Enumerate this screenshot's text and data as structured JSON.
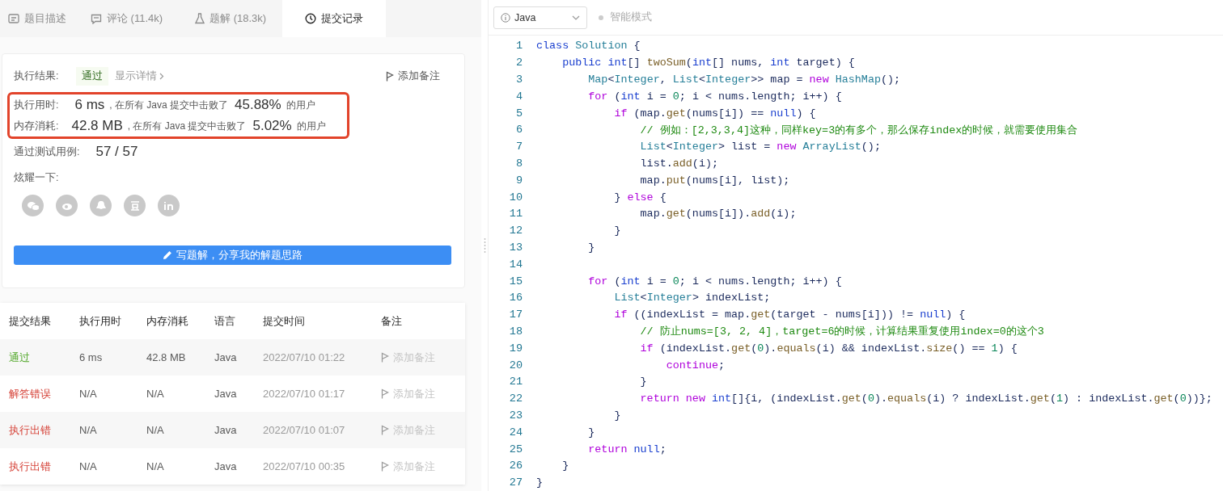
{
  "tabs": [
    {
      "label": "题目描述",
      "selected": false
    },
    {
      "label": "评论 (11.4k)",
      "selected": false
    },
    {
      "label": "题解 (18.3k)",
      "selected": false
    },
    {
      "label": "提交记录",
      "selected": true
    }
  ],
  "result": {
    "label": "执行结果:",
    "status": "通过",
    "details_link": "显示详情",
    "note_button": "添加备注"
  },
  "stats": {
    "highlighted": true,
    "rows": [
      {
        "label": "执行用时:",
        "value": "6 ms",
        "text": ", 在所有 Java 提交中击败了",
        "percent": "45.88%",
        "suffix": "的用户"
      },
      {
        "label": "内存消耗:",
        "value": "42.8 MB",
        "text": ", 在所有 Java 提交中击败了",
        "percent": "5.02%",
        "suffix": "的用户"
      }
    ]
  },
  "tests": {
    "label": "通过测试用例:",
    "value": "57 / 57"
  },
  "share": {
    "label": "炫耀一下:"
  },
  "write_button": "写题解，分享我的解题思路",
  "table": {
    "columns": [
      "提交结果",
      "执行用时",
      "内存消耗",
      "语言",
      "提交时间",
      "备注"
    ],
    "rows": [
      {
        "result": "通过",
        "kind": "pass",
        "time": "6 ms",
        "memory": "42.8 MB",
        "language": "Java",
        "submitted": "2022/07/10 01:22",
        "note": "添加备注"
      },
      {
        "result": "解答错误",
        "kind": "fail",
        "time": "N/A",
        "memory": "N/A",
        "language": "Java",
        "submitted": "2022/07/10 01:17",
        "note": "添加备注"
      },
      {
        "result": "执行出错",
        "kind": "fail",
        "time": "N/A",
        "memory": "N/A",
        "language": "Java",
        "submitted": "2022/07/10 01:07",
        "note": "添加备注"
      },
      {
        "result": "执行出错",
        "kind": "fail",
        "time": "N/A",
        "memory": "N/A",
        "language": "Java",
        "submitted": "2022/07/10 00:35",
        "note": "添加备注"
      }
    ]
  },
  "editor": {
    "language": "Java",
    "mode": "智能模式",
    "lines": [
      {
        "number": "1",
        "tokens": [
          {
            "kind": "keyword",
            "text": "class"
          },
          {
            "kind": "type",
            "text": " Solution"
          },
          {
            "kind": "plain",
            "text": " {"
          }
        ]
      },
      {
        "number": "2",
        "tokens": [
          {
            "kind": "keyword",
            "text": "    public"
          },
          {
            "kind": "keyword",
            "text": " int"
          },
          {
            "kind": "plain",
            "text": "[] "
          },
          {
            "kind": "function",
            "text": "twoSum"
          },
          {
            "kind": "plain",
            "text": "("
          },
          {
            "kind": "keyword",
            "text": "int"
          },
          {
            "kind": "plain",
            "text": "[] nums, "
          },
          {
            "kind": "keyword",
            "text": "int"
          },
          {
            "kind": "plain",
            "text": " target) {"
          }
        ]
      },
      {
        "number": "3",
        "tokens": [
          {
            "kind": "type",
            "text": "        Map"
          },
          {
            "kind": "plain",
            "text": "<"
          },
          {
            "kind": "type",
            "text": "Integer"
          },
          {
            "kind": "plain",
            "text": ", "
          },
          {
            "kind": "type",
            "text": "List"
          },
          {
            "kind": "plain",
            "text": "<"
          },
          {
            "kind": "type",
            "text": "Integer"
          },
          {
            "kind": "plain",
            "text": ">> map = "
          },
          {
            "kind": "control",
            "text": "new"
          },
          {
            "kind": "type",
            "text": " HashMap"
          },
          {
            "kind": "plain",
            "text": "();"
          }
        ]
      },
      {
        "number": "4",
        "tokens": [
          {
            "kind": "control",
            "text": "        for"
          },
          {
            "kind": "plain",
            "text": " ("
          },
          {
            "kind": "keyword",
            "text": "int"
          },
          {
            "kind": "plain",
            "text": " i = "
          },
          {
            "kind": "number",
            "text": "0"
          },
          {
            "kind": "plain",
            "text": "; i < nums.length; i++) {"
          }
        ]
      },
      {
        "number": "5",
        "tokens": [
          {
            "kind": "control",
            "text": "            if"
          },
          {
            "kind": "plain",
            "text": " (map."
          },
          {
            "kind": "function",
            "text": "get"
          },
          {
            "kind": "plain",
            "text": "(nums[i]) == "
          },
          {
            "kind": "keyword",
            "text": "null"
          },
          {
            "kind": "plain",
            "text": ") {"
          }
        ]
      },
      {
        "number": "6",
        "tokens": [
          {
            "kind": "comment",
            "text": "                // 例如：[2,3,3,4]这种，同样key=3的有多个，那么保存index的时候，就需要使用集合"
          }
        ]
      },
      {
        "number": "7",
        "tokens": [
          {
            "kind": "type",
            "text": "                List"
          },
          {
            "kind": "plain",
            "text": "<"
          },
          {
            "kind": "type",
            "text": "Integer"
          },
          {
            "kind": "plain",
            "text": "> list = "
          },
          {
            "kind": "control",
            "text": "new"
          },
          {
            "kind": "type",
            "text": " ArrayList"
          },
          {
            "kind": "plain",
            "text": "();"
          }
        ]
      },
      {
        "number": "8",
        "tokens": [
          {
            "kind": "plain",
            "text": "                list."
          },
          {
            "kind": "function",
            "text": "add"
          },
          {
            "kind": "plain",
            "text": "(i);"
          }
        ]
      },
      {
        "number": "9",
        "tokens": [
          {
            "kind": "plain",
            "text": "                map."
          },
          {
            "kind": "function",
            "text": "put"
          },
          {
            "kind": "plain",
            "text": "(nums[i], list);"
          }
        ]
      },
      {
        "number": "10",
        "tokens": [
          {
            "kind": "plain",
            "text": "            } "
          },
          {
            "kind": "control",
            "text": "else"
          },
          {
            "kind": "plain",
            "text": " {"
          }
        ]
      },
      {
        "number": "11",
        "tokens": [
          {
            "kind": "plain",
            "text": "                map."
          },
          {
            "kind": "function",
            "text": "get"
          },
          {
            "kind": "plain",
            "text": "(nums[i])."
          },
          {
            "kind": "function",
            "text": "add"
          },
          {
            "kind": "plain",
            "text": "(i);"
          }
        ]
      },
      {
        "number": "12",
        "tokens": [
          {
            "kind": "plain",
            "text": "            }"
          }
        ]
      },
      {
        "number": "13",
        "tokens": [
          {
            "kind": "plain",
            "text": "        }"
          }
        ]
      },
      {
        "number": "14"
      },
      {
        "number": "15",
        "tokens": [
          {
            "kind": "control",
            "text": "        for"
          },
          {
            "kind": "plain",
            "text": " ("
          },
          {
            "kind": "keyword",
            "text": "int"
          },
          {
            "kind": "plain",
            "text": " i = "
          },
          {
            "kind": "number",
            "text": "0"
          },
          {
            "kind": "plain",
            "text": "; i < nums.length; i++) {"
          }
        ]
      },
      {
        "number": "16",
        "tokens": [
          {
            "kind": "type",
            "text": "            List"
          },
          {
            "kind": "plain",
            "text": "<"
          },
          {
            "kind": "type",
            "text": "Integer"
          },
          {
            "kind": "plain",
            "text": "> indexList;"
          }
        ]
      },
      {
        "number": "17",
        "tokens": [
          {
            "kind": "control",
            "text": "            if"
          },
          {
            "kind": "plain",
            "text": " ((indexList = map."
          },
          {
            "kind": "function",
            "text": "get"
          },
          {
            "kind": "plain",
            "text": "(target - nums[i])) != "
          },
          {
            "kind": "keyword",
            "text": "null"
          },
          {
            "kind": "plain",
            "text": ") {"
          }
        ]
      },
      {
        "number": "18",
        "tokens": [
          {
            "kind": "comment",
            "text": "                // 防止nums=[3, 2, 4]，target=6的时候，计算结果重复使用index=0的这个3"
          }
        ]
      },
      {
        "number": "19",
        "tokens": [
          {
            "kind": "control",
            "text": "                if"
          },
          {
            "kind": "plain",
            "text": " (indexList."
          },
          {
            "kind": "function",
            "text": "get"
          },
          {
            "kind": "plain",
            "text": "("
          },
          {
            "kind": "number",
            "text": "0"
          },
          {
            "kind": "plain",
            "text": ")."
          },
          {
            "kind": "function",
            "text": "equals"
          },
          {
            "kind": "plain",
            "text": "(i) && indexList."
          },
          {
            "kind": "function",
            "text": "size"
          },
          {
            "kind": "plain",
            "text": "() == "
          },
          {
            "kind": "number",
            "text": "1"
          },
          {
            "kind": "plain",
            "text": ") {"
          }
        ]
      },
      {
        "number": "20",
        "tokens": [
          {
            "kind": "control",
            "text": "                    continue"
          },
          {
            "kind": "plain",
            "text": ";"
          }
        ]
      },
      {
        "number": "21",
        "tokens": [
          {
            "kind": "plain",
            "text": "                }"
          }
        ]
      },
      {
        "number": "22",
        "tokens": [
          {
            "kind": "control",
            "text": "                return"
          },
          {
            "kind": "control",
            "text": " new"
          },
          {
            "kind": "keyword",
            "text": " int"
          },
          {
            "kind": "plain",
            "text": "[]{i, (indexList."
          },
          {
            "kind": "function",
            "text": "get"
          },
          {
            "kind": "plain",
            "text": "("
          },
          {
            "kind": "number",
            "text": "0"
          },
          {
            "kind": "plain",
            "text": ")."
          },
          {
            "kind": "function",
            "text": "equals"
          },
          {
            "kind": "plain",
            "text": "(i) ? indexList."
          },
          {
            "kind": "function",
            "text": "get"
          },
          {
            "kind": "plain",
            "text": "("
          },
          {
            "kind": "number",
            "text": "1"
          },
          {
            "kind": "plain",
            "text": ") : indexList."
          },
          {
            "kind": "function",
            "text": "get"
          },
          {
            "kind": "plain",
            "text": "("
          },
          {
            "kind": "number",
            "text": "0"
          },
          {
            "kind": "plain",
            "text": "))};"
          }
        ]
      },
      {
        "number": "23",
        "tokens": [
          {
            "kind": "plain",
            "text": "            }"
          }
        ]
      },
      {
        "number": "24",
        "tokens": [
          {
            "kind": "plain",
            "text": "        }"
          }
        ]
      },
      {
        "number": "25",
        "tokens": [
          {
            "kind": "control",
            "text": "        return"
          },
          {
            "kind": "keyword",
            "text": " null"
          },
          {
            "kind": "plain",
            "text": ";"
          }
        ]
      },
      {
        "number": "26",
        "tokens": [
          {
            "kind": "plain",
            "text": "    }"
          }
        ]
      },
      {
        "number": "27",
        "tokens": [
          {
            "kind": "plain",
            "text": "}"
          }
        ]
      }
    ]
  }
}
